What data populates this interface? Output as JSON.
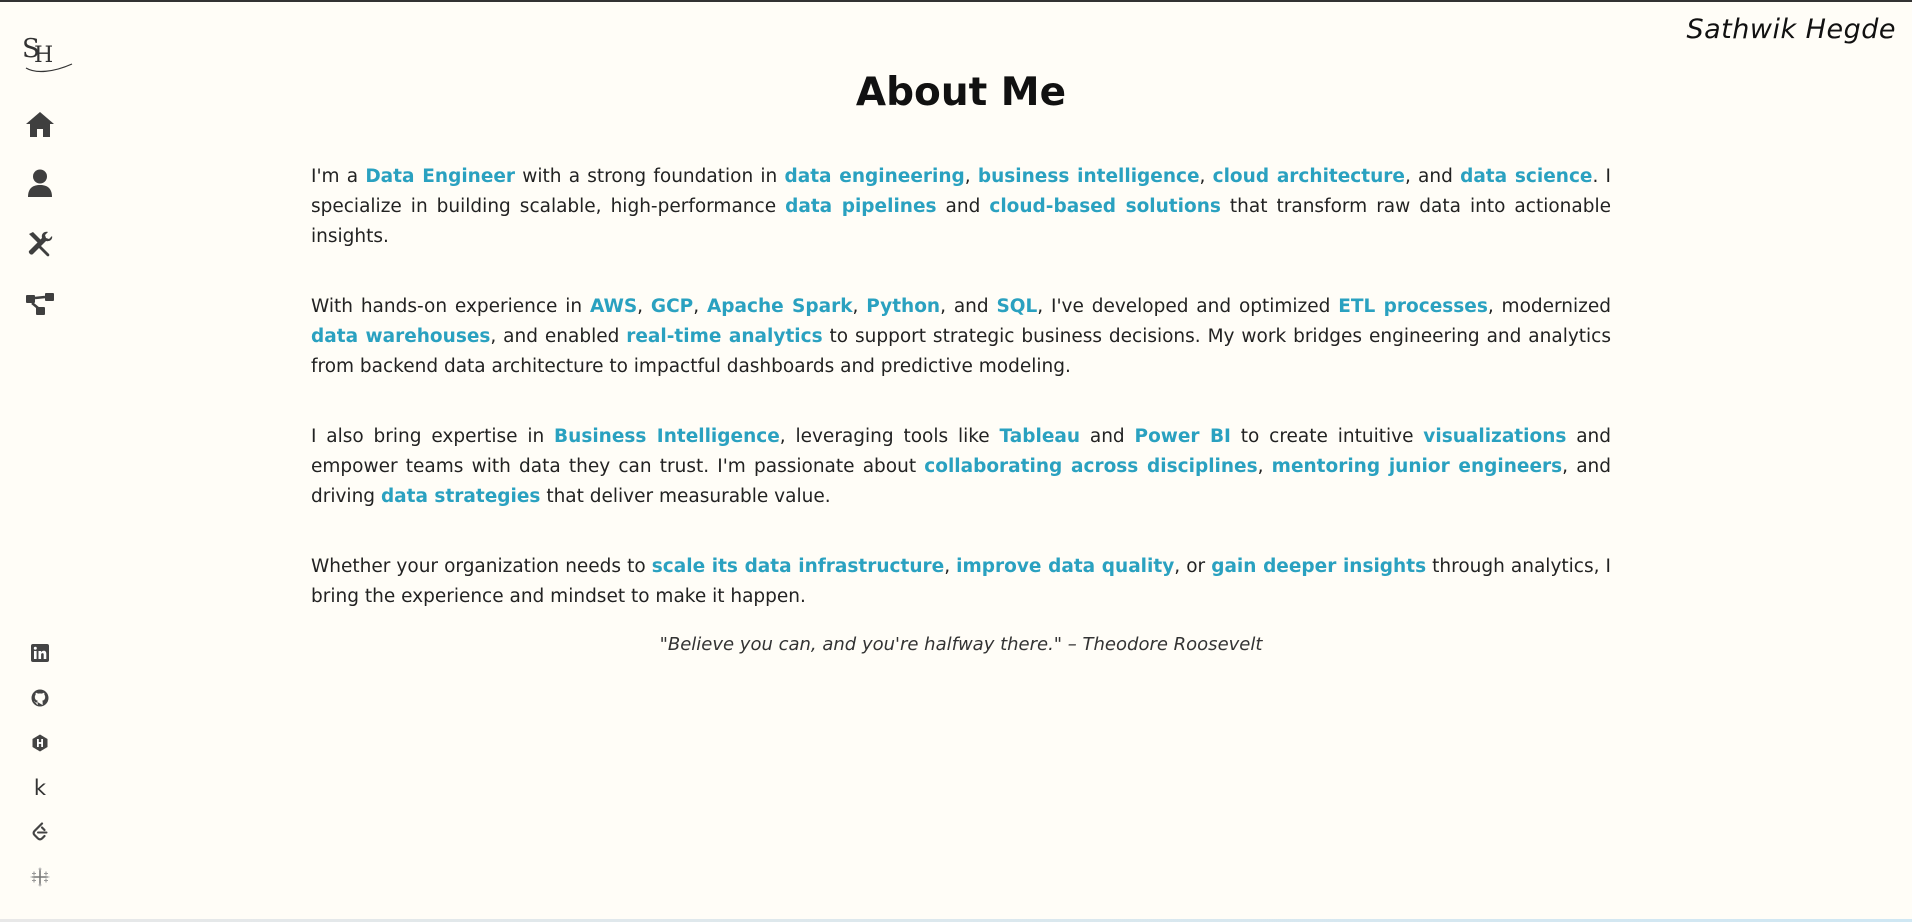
{
  "header": {
    "logo_text_1": "S",
    "logo_text_2": "H",
    "signature": "Sathwik Hegde"
  },
  "sidebar": {
    "nav_items": [
      {
        "name": "home",
        "icon": "home-icon"
      },
      {
        "name": "about",
        "icon": "user-icon"
      },
      {
        "name": "skills",
        "icon": "tools-icon"
      },
      {
        "name": "projects",
        "icon": "diagram-icon"
      }
    ],
    "social_items": [
      {
        "name": "linkedin",
        "icon": "linkedin-icon",
        "label": "in"
      },
      {
        "name": "github",
        "icon": "github-icon"
      },
      {
        "name": "hashnode",
        "icon": "hashnode-icon"
      },
      {
        "name": "kaggle",
        "icon": "kaggle-icon",
        "label": "k"
      },
      {
        "name": "leetcode",
        "icon": "leetcode-icon"
      },
      {
        "name": "tableau",
        "icon": "tableau-icon"
      }
    ]
  },
  "main": {
    "title": "About Me",
    "paragraphs": [
      [
        {
          "t": "I'm a "
        },
        {
          "t": "Data Engineer",
          "h": true
        },
        {
          "t": " with a strong foundation in "
        },
        {
          "t": "data engineering",
          "h": true
        },
        {
          "t": ", "
        },
        {
          "t": "business intelligence",
          "h": true
        },
        {
          "t": ", "
        },
        {
          "t": "cloud architecture",
          "h": true
        },
        {
          "t": ", and "
        },
        {
          "t": "data science",
          "h": true
        },
        {
          "t": ". I specialize in building scalable, high-performance "
        },
        {
          "t": "data pipelines",
          "h": true
        },
        {
          "t": " and "
        },
        {
          "t": "cloud-based solutions",
          "h": true
        },
        {
          "t": " that transform raw data into actionable insights."
        }
      ],
      [
        {
          "t": "With hands-on experience in "
        },
        {
          "t": "AWS",
          "h": true
        },
        {
          "t": ", "
        },
        {
          "t": "GCP",
          "h": true
        },
        {
          "t": ", "
        },
        {
          "t": "Apache Spark",
          "h": true
        },
        {
          "t": ", "
        },
        {
          "t": "Python",
          "h": true
        },
        {
          "t": ", and "
        },
        {
          "t": "SQL",
          "h": true
        },
        {
          "t": ", I've developed and optimized "
        },
        {
          "t": "ETL processes",
          "h": true
        },
        {
          "t": ", modernized "
        },
        {
          "t": "data warehouses",
          "h": true
        },
        {
          "t": ", and enabled "
        },
        {
          "t": "real-time analytics",
          "h": true
        },
        {
          "t": " to support strategic business decisions. My work bridges engineering and analytics from backend data architecture to impactful dashboards and predictive modeling."
        }
      ],
      [
        {
          "t": "I also bring expertise in "
        },
        {
          "t": "Business Intelligence",
          "h": true
        },
        {
          "t": ", leveraging tools like "
        },
        {
          "t": "Tableau",
          "h": true
        },
        {
          "t": " and "
        },
        {
          "t": "Power BI",
          "h": true
        },
        {
          "t": " to create intuitive "
        },
        {
          "t": "visualizations",
          "h": true
        },
        {
          "t": " and empower teams with data they can trust. I'm passionate about "
        },
        {
          "t": "collaborating across disciplines",
          "h": true
        },
        {
          "t": ", "
        },
        {
          "t": "mentoring junior engineers",
          "h": true
        },
        {
          "t": ", and driving "
        },
        {
          "t": "data strategies",
          "h": true
        },
        {
          "t": " that deliver measurable value."
        }
      ],
      [
        {
          "t": "Whether your organization needs to "
        },
        {
          "t": "scale its data infrastructure",
          "h": true
        },
        {
          "t": ", "
        },
        {
          "t": "improve data quality",
          "h": true
        },
        {
          "t": ", or "
        },
        {
          "t": "gain deeper insights",
          "h": true
        },
        {
          "t": " through analytics, I bring the experience and mindset to make it happen."
        }
      ]
    ],
    "quote": "\"Believe you can, and you're halfway there.\" – Theodore Roosevelt"
  },
  "colors": {
    "background": "#fffdf7",
    "accent": "#2aa1c0",
    "text": "#222222",
    "icon": "#444444"
  }
}
